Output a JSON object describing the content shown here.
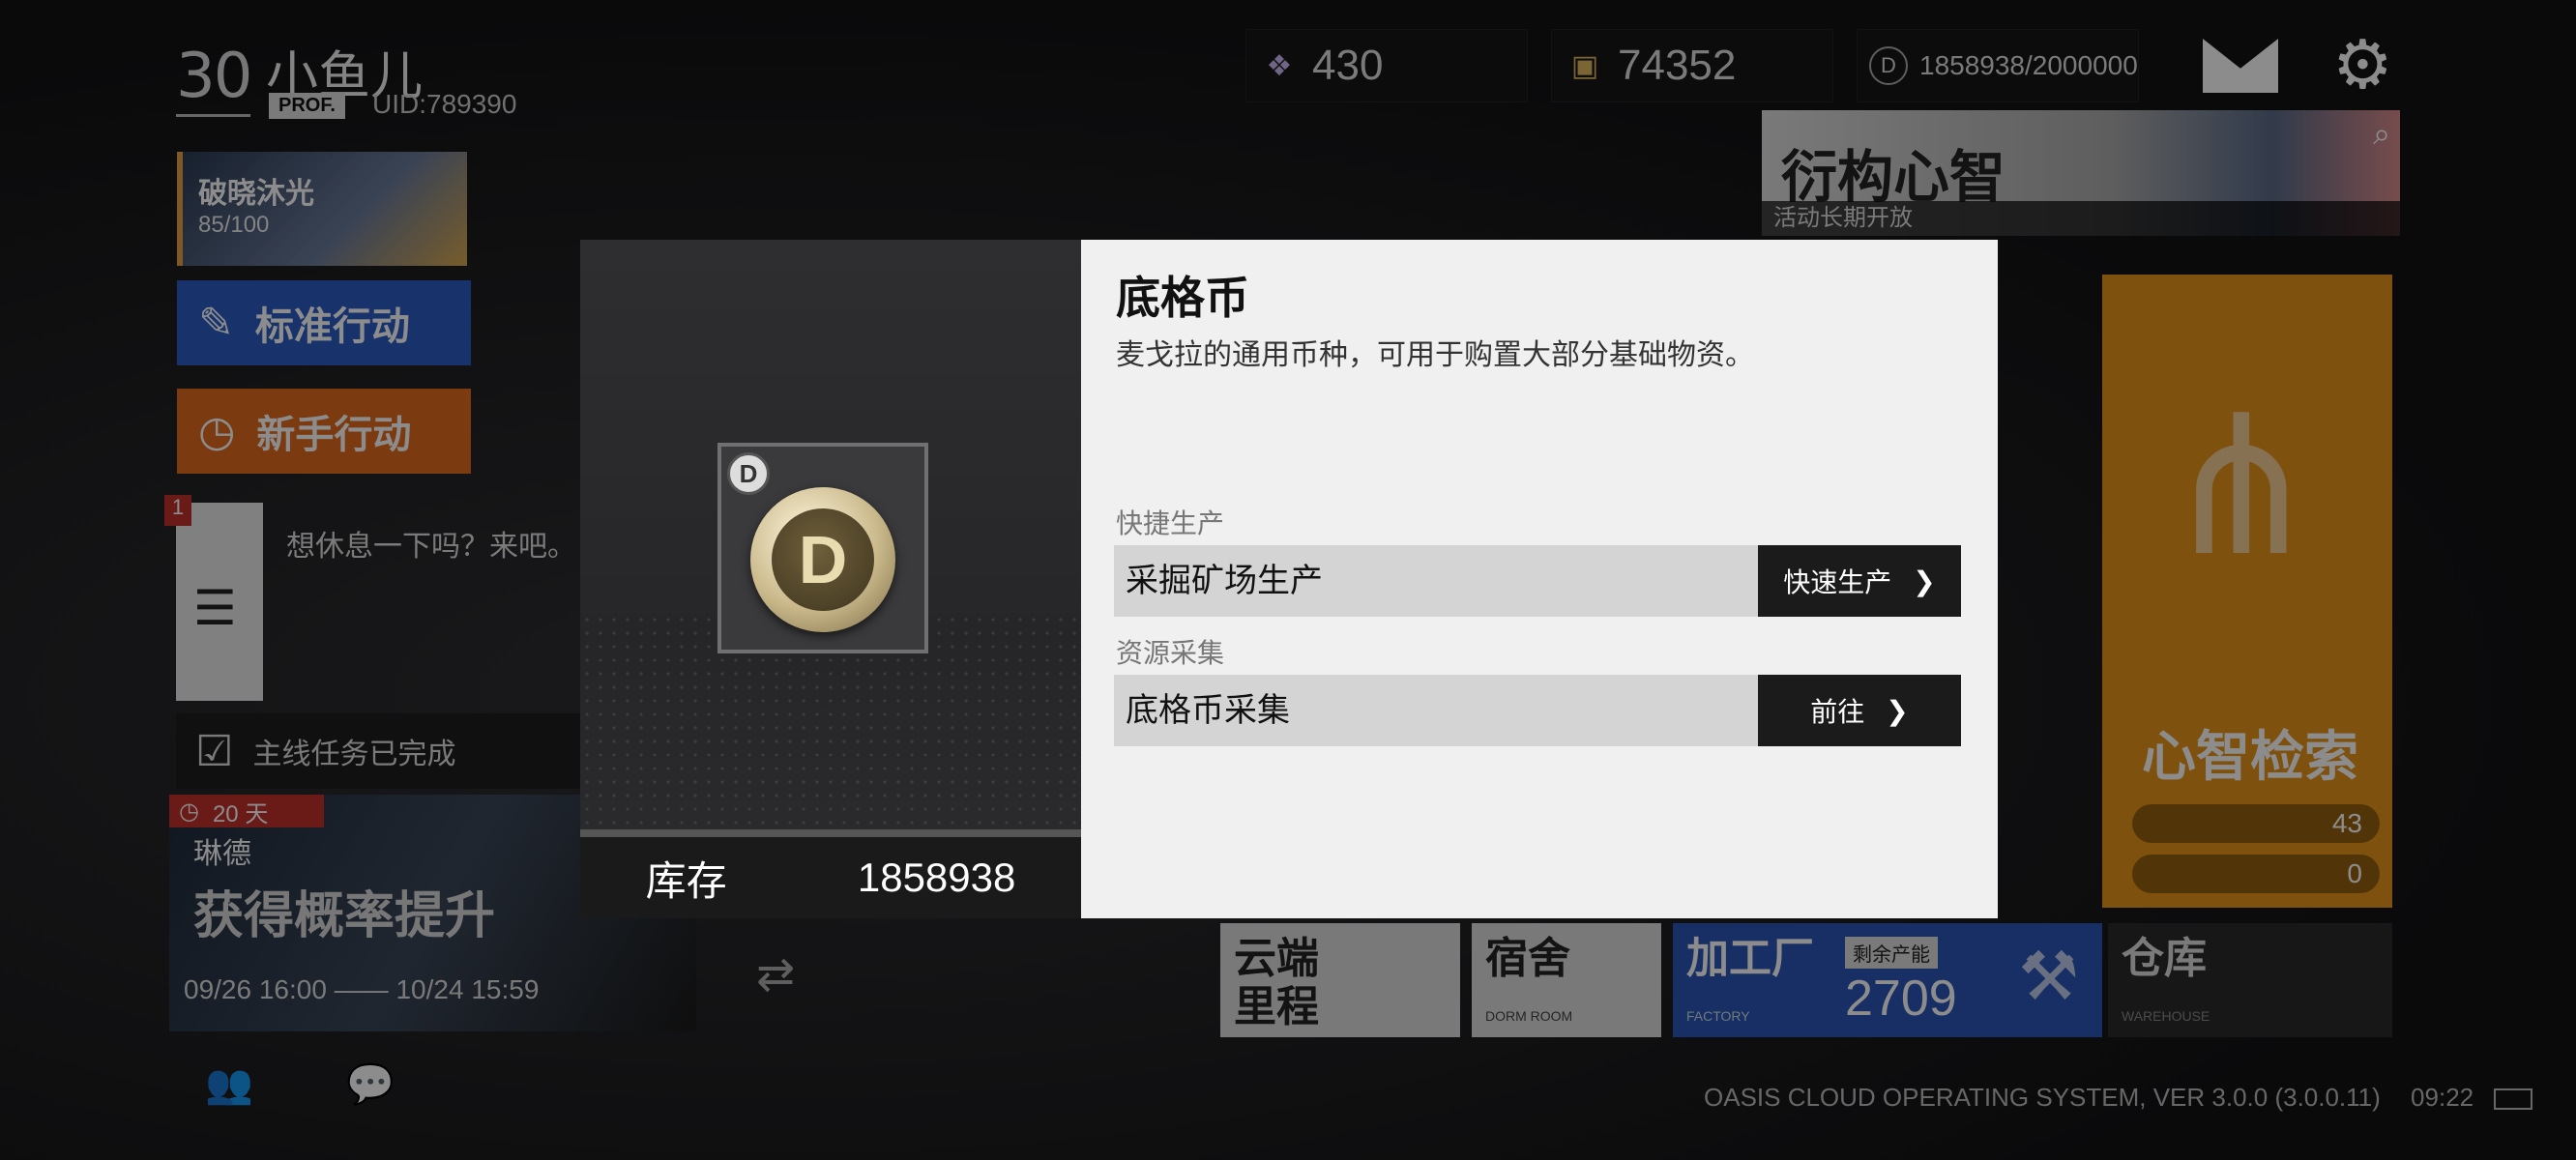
{
  "player": {
    "level": "30",
    "name": "小鱼儿",
    "prof": "PROF.",
    "uid": "UID:789390"
  },
  "resources": {
    "crystals": "430",
    "materials": "74352",
    "coins": "1858938/2000000"
  },
  "left_panel": {
    "banner_title": "破晓沐光",
    "banner_sub": "85/100",
    "standard_action": "标准行动",
    "newbie_action": "新手行动",
    "rest_badge": "1",
    "rest_text": "想休息一下吗？来吧。",
    "mission_text": "主线任务已完成",
    "event_days": "20 天",
    "event_name": "琳德",
    "event_title": "获得概率提升",
    "event_dates": "09/26 16:00 —— 10/24 15:59"
  },
  "right_panel": {
    "banner_title": "衍构心智",
    "banner_sub": "活动长期开放",
    "neural_title": "心智检索",
    "neural_count_1": "43",
    "neural_count_2": "0"
  },
  "tiles": {
    "cloud": "云端\n里程",
    "dorm": "宿舍",
    "dorm_sub": "DORM ROOM",
    "factory": "加工厂",
    "factory_sub": "FACTORY",
    "factory_label": "剩余产能",
    "factory_value": "2709",
    "warehouse": "仓库",
    "warehouse_sub": "WAREHOUSE"
  },
  "status": {
    "system": "OASIS CLOUD OPERATING SYSTEM, VER 3.0.0 (3.0.0.11)",
    "time": "09:22"
  },
  "modal": {
    "item_name": "底格币",
    "description": "麦戈拉的通用币种，可用于购置大部分基础物资。",
    "stock_label": "库存",
    "stock_value": "1858938",
    "section_quick": "快捷生产",
    "row_quick_label": "采掘矿场生产",
    "row_quick_button": "快速生产",
    "section_collect": "资源采集",
    "row_collect_label": "底格币采集",
    "row_collect_button": "前往"
  },
  "colors": {
    "accent_blue": "#2c5bc4",
    "accent_orange": "#e0691c",
    "neural_orange": "#e7931a",
    "factory_blue": "#2b56b8"
  }
}
